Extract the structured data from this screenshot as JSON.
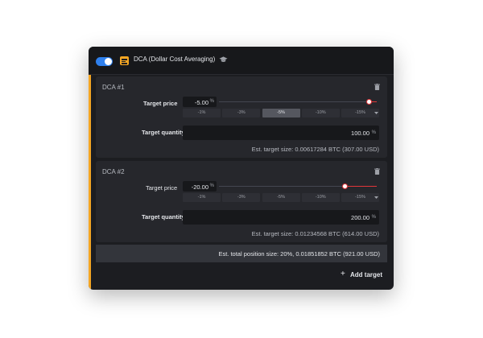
{
  "header": {
    "enabled": true,
    "title": "DCA (Dollar Cost Averaging)",
    "logo_icon": "strategy-logo-icon",
    "info_icon": "graduation-cap-icon"
  },
  "colors": {
    "accent": "#f5a623",
    "toggle_on": "#2f80ed",
    "slider": "#e2363a",
    "panel": "#1c1d21",
    "card": "#26272c"
  },
  "targets": [
    {
      "label": "DCA #1",
      "price_label": "Target price",
      "price_value": "-5.00",
      "price_unit": "%",
      "slider_fraction": 0.05,
      "presets": [
        "-1%",
        "-3%",
        "-5%",
        "-10%",
        "-15%"
      ],
      "active_preset": 2,
      "quantity_label": "Target quantity",
      "quantity_value": "100.00",
      "quantity_unit": "%",
      "estimate": "Est. target size: 0.00617284 BTC (307.00 USD)"
    },
    {
      "label": "DCA #2",
      "price_label": "Target price",
      "price_value": "-20.00",
      "price_unit": "%",
      "slider_fraction": 0.2,
      "presets": [
        "-1%",
        "-3%",
        "-5%",
        "-10%",
        "-15%"
      ],
      "active_preset": null,
      "quantity_label": "Target quantity",
      "quantity_value": "200.00",
      "quantity_unit": "%",
      "estimate": "Est. target size: 0.01234568 BTC (614.00 USD)"
    }
  ],
  "total": "Est. total position size: 20%, 0.01851852 BTC (921.00 USD)",
  "add_target_label": "Add target"
}
